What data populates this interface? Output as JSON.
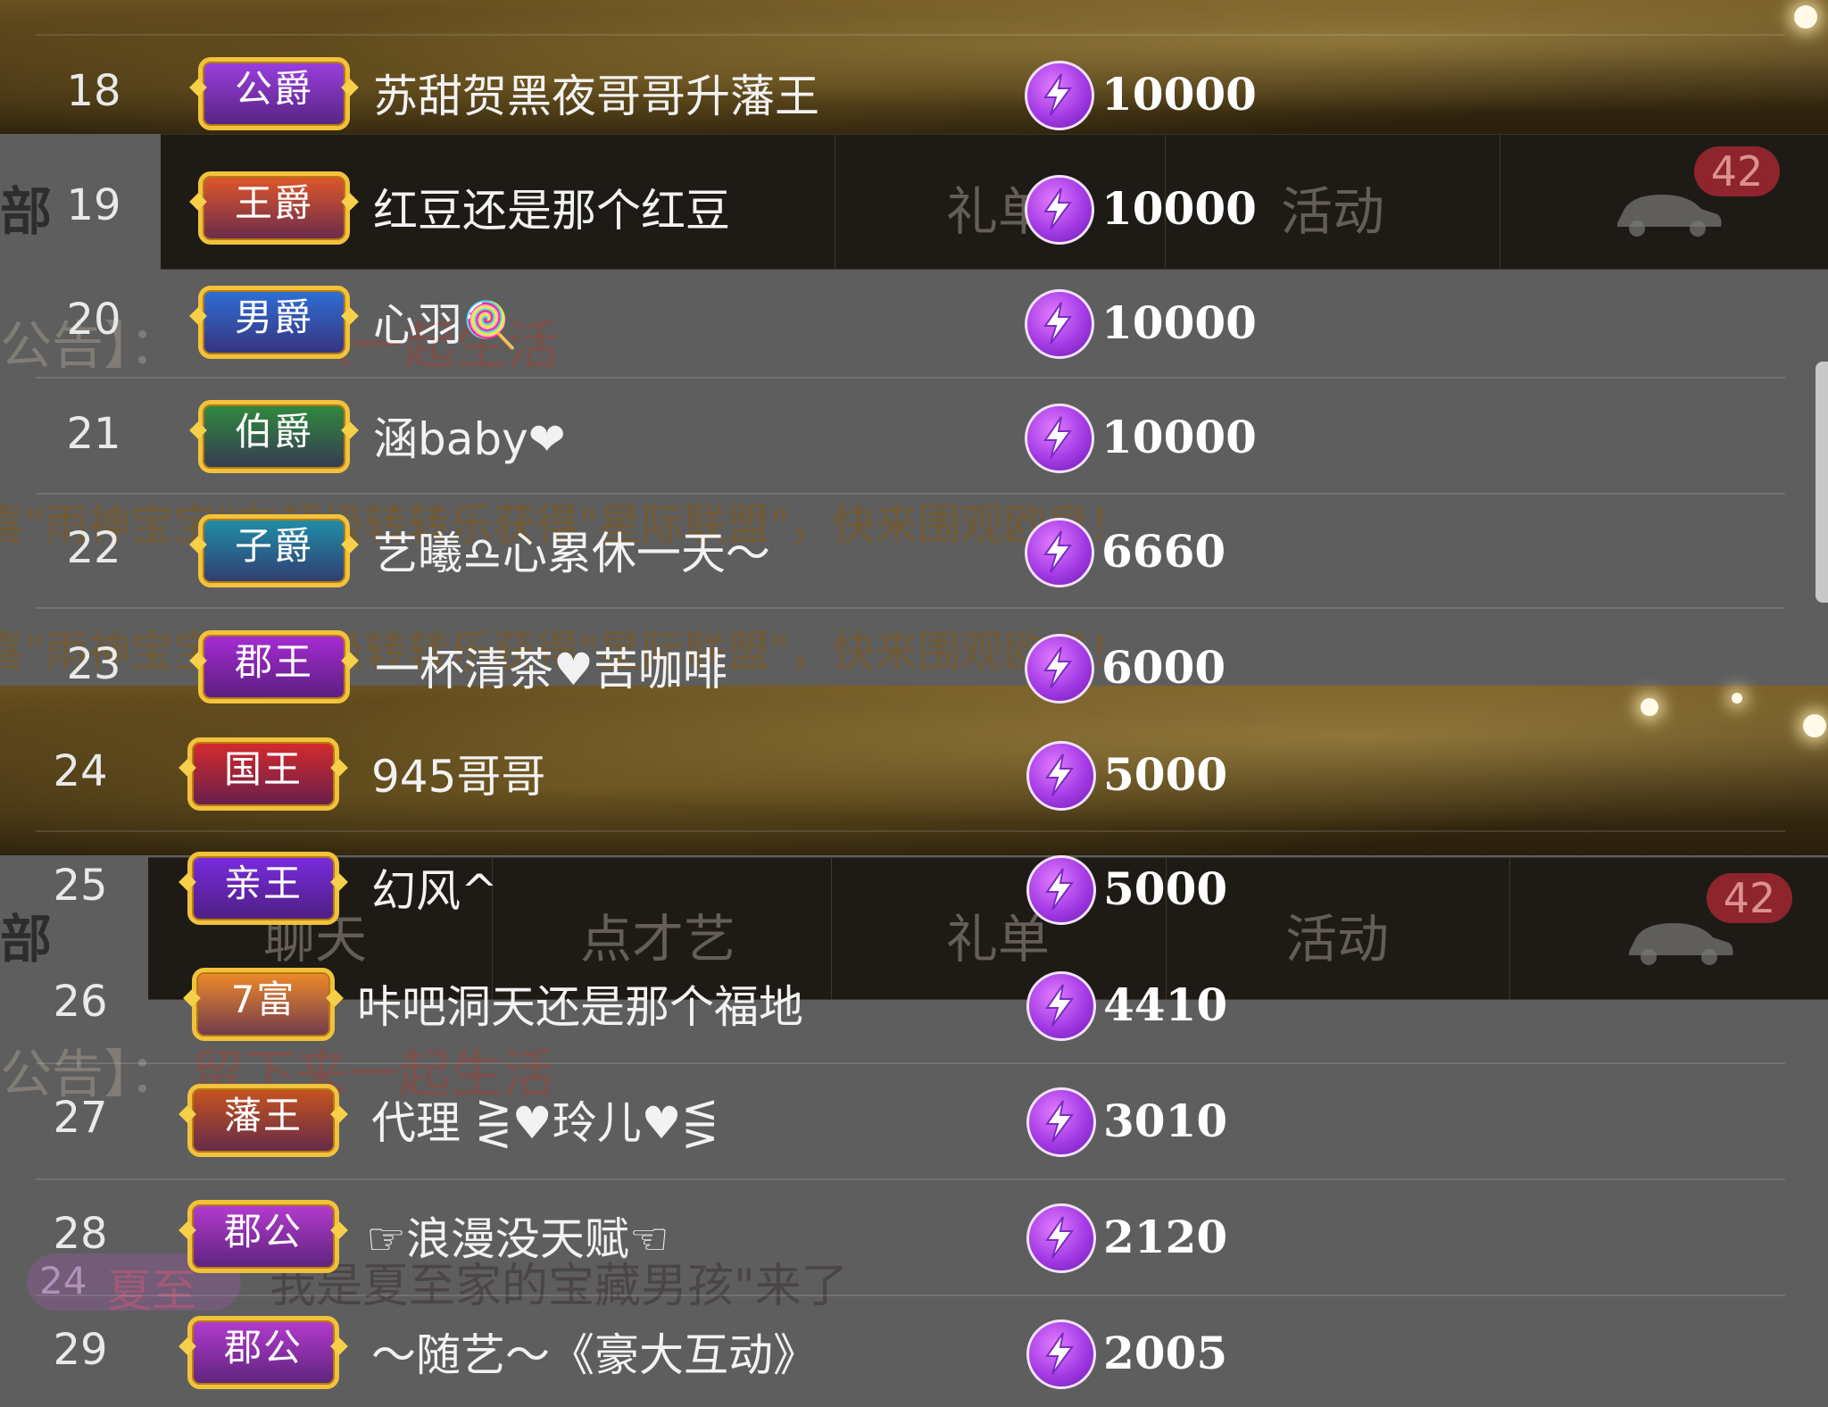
{
  "ghost_tabs": [
    "聊天",
    "点才艺",
    "礼单",
    "活动"
  ],
  "ghost_tab_short": "礼单",
  "ghost_side_label": "部",
  "ghost_badge": "42",
  "ghost_notice_prefix": "公告】：",
  "ghost_notice_text": "留下来一起生活",
  "ghost_broadcast": "喜\"雨神宝宝\"在超级转转乐获得\"星际联盟\"，快来围观欧皇！",
  "ghost_enter_badge": "24",
  "ghost_enter_name": "夏至",
  "ghost_enter_text": "我是夏至家的宝藏男孩\"来了",
  "colors": {
    "accent_gold": "#f2c23b",
    "coin_purple": "#a43be5"
  },
  "rows": [
    {
      "rank": "18",
      "title": "公爵",
      "name": "苏甜贺黑夜哥哥升藩王",
      "amount": "10000",
      "badge_color": "#9b3fe0"
    },
    {
      "rank": "19",
      "title": "王爵",
      "name": "红豆还是那个红豆",
      "amount": "10000",
      "badge_color": "#e0572a"
    },
    {
      "rank": "20",
      "title": "男爵",
      "name": "心羽🍭",
      "amount": "10000",
      "badge_color": "#2f6fd6"
    },
    {
      "rank": "21",
      "title": "伯爵",
      "name": "涵baby❤",
      "amount": "10000",
      "badge_color": "#2f8a3e"
    },
    {
      "rank": "22",
      "title": "子爵",
      "name": "艺曦♎心累休一天～",
      "amount": "6660",
      "badge_color": "#1f8fa8"
    },
    {
      "rank": "23",
      "title": "郡王",
      "name": "一杯清茶♥苦咖啡",
      "amount": "6000",
      "badge_color": "#a82bd6"
    },
    {
      "rank": "24",
      "title": "国王",
      "name": "945哥哥",
      "amount": "5000",
      "badge_color": "#d62b2b"
    },
    {
      "rank": "25",
      "title": "亲王",
      "name": "幻风^",
      "amount": "5000",
      "badge_color": "#7a2be0"
    },
    {
      "rank": "26",
      "title": "7富",
      "name": "咔吧洞天还是那个福地",
      "amount": "4410",
      "badge_color": "#f08a2a"
    },
    {
      "rank": "27",
      "title": "藩王",
      "name": "代理 ⋛♥玲儿♥⋚",
      "amount": "3010",
      "badge_color": "#c8541f"
    },
    {
      "rank": "28",
      "title": "郡公",
      "name": "☞浪漫没天赋☜",
      "amount": "2120",
      "badge_color": "#b43bd0"
    },
    {
      "rank": "29",
      "title": "郡公",
      "name": "～随艺～《豪大互动》",
      "amount": "2005",
      "badge_color": "#b43bd0"
    }
  ]
}
